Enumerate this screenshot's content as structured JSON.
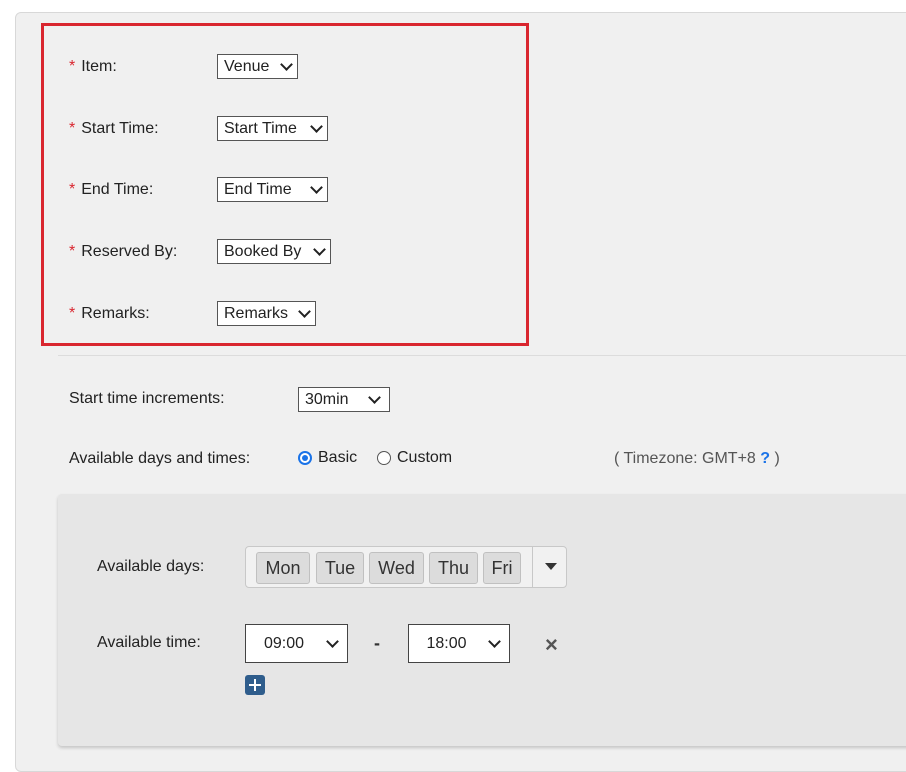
{
  "mapping": {
    "fields": [
      {
        "label": "Item:",
        "value": "Venue"
      },
      {
        "label": "Start Time:",
        "value": "Start Time"
      },
      {
        "label": "End Time:",
        "value": "End Time"
      },
      {
        "label": "Reserved By:",
        "value": "Booked By"
      },
      {
        "label": "Remarks:",
        "value": "Remarks"
      }
    ],
    "required_mark": "*"
  },
  "increments": {
    "label": "Start time increments:",
    "value": "30min"
  },
  "availability": {
    "label": "Available days and times:",
    "options": [
      "Basic",
      "Custom"
    ],
    "selected": "Basic",
    "timezone_prefix": "( Timezone: GMT+8",
    "timezone_help": "?",
    "timezone_suffix": ")"
  },
  "days": {
    "label": "Available days:",
    "selected": [
      "Mon",
      "Tue",
      "Wed",
      "Thu",
      "Fri"
    ]
  },
  "time": {
    "label": "Available time:",
    "start": "09:00",
    "separator": "-",
    "end": "18:00",
    "remove_symbol": "×"
  },
  "colors": {
    "accent": "#1a73e8",
    "highlight": "#d9262f",
    "add_button": "#2f5d8c"
  },
  "icons": {
    "add": "plus-square-icon",
    "remove": "close-icon",
    "help": "question-icon",
    "dropdown": "chevron-down-icon"
  }
}
